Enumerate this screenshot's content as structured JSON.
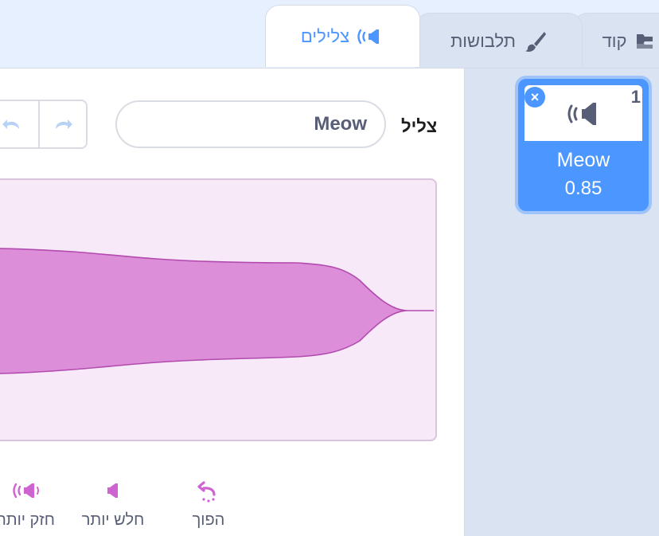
{
  "tabs": [
    {
      "label": "קוד",
      "icon": "code-icon"
    },
    {
      "label": "תלבושות",
      "icon": "paintbrush-icon"
    },
    {
      "label": "צלילים",
      "icon": "speaker-icon",
      "active": true
    }
  ],
  "editor": {
    "sound_label": "צליל",
    "sound_name_value": "Meow",
    "undo_icon": "undo-icon",
    "redo_icon": "redo-icon"
  },
  "effects": [
    {
      "label": "הפוך",
      "icon": "reverse-icon"
    },
    {
      "label": "חלש יותר",
      "icon": "softer-icon"
    },
    {
      "label": "חזק יותר",
      "icon": "louder-icon"
    }
  ],
  "sound_list": [
    {
      "index": "1",
      "name": "Meow",
      "duration": "0.85",
      "icon": "speaker-icon",
      "selected": true
    }
  ],
  "colors": {
    "accent": "#4c97ff",
    "waveform_fill": "#dc8ed8",
    "waveform_stroke": "#b24ab0",
    "waveform_bg": "#f7e9f8",
    "effect_icon": "#cf63cf"
  }
}
